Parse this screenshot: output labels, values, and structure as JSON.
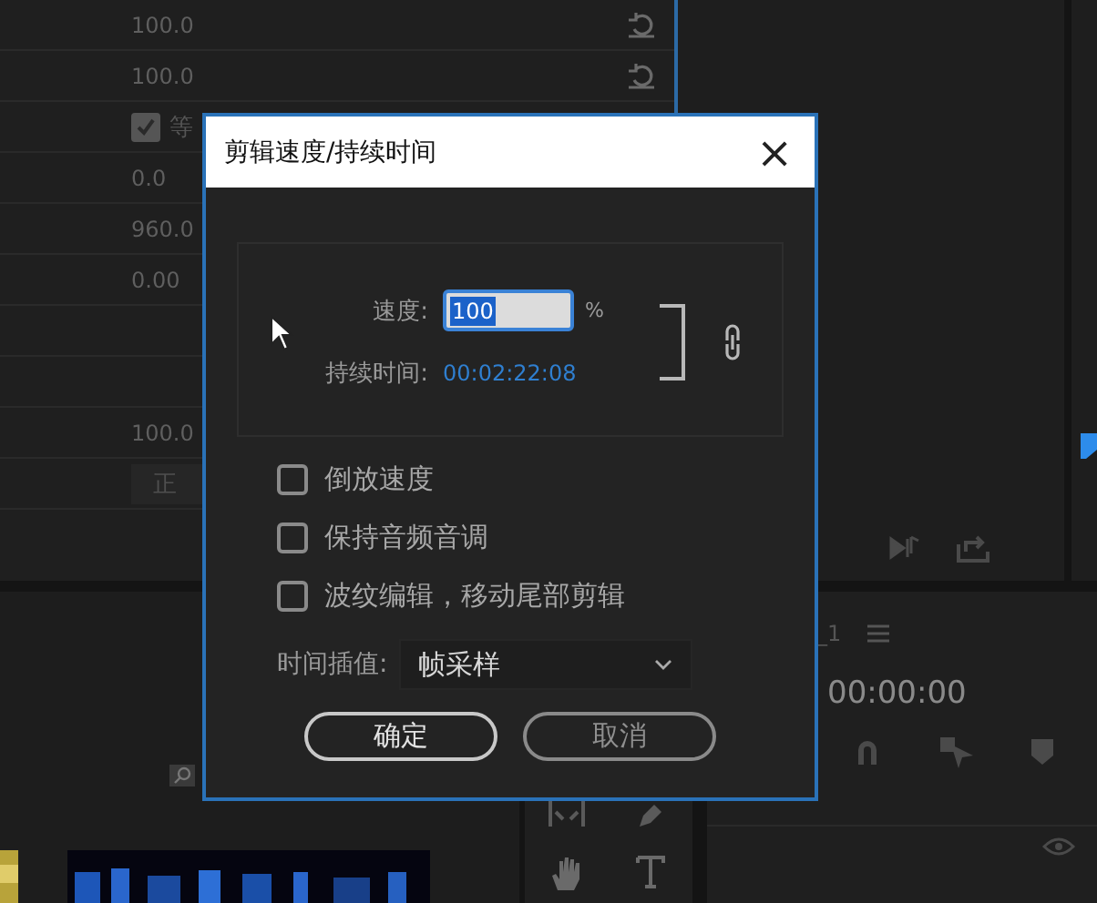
{
  "effect_controls": {
    "rows": [
      {
        "kind": "value_reset",
        "value": "100.0"
      },
      {
        "kind": "value_reset",
        "value": "100.0"
      },
      {
        "kind": "checkbox",
        "label": "等",
        "checked": true
      },
      {
        "kind": "value",
        "value": "0.0"
      },
      {
        "kind": "value",
        "value": "960.0"
      },
      {
        "kind": "value",
        "value": "0.00"
      },
      {
        "kind": "blank"
      },
      {
        "kind": "blank"
      },
      {
        "kind": "value",
        "value": "100.0"
      },
      {
        "kind": "dropdown",
        "value": "正"
      }
    ]
  },
  "timeline": {
    "sequence_name": "_1",
    "timecode": "00:00:00"
  },
  "dialog": {
    "title": "剪辑速度/持续时间",
    "close": "×",
    "speed_label": "速度:",
    "speed_value": "100",
    "speed_unit": "%",
    "duration_label": "持续时间:",
    "duration_value": "00:02:22:08",
    "linked": true,
    "options": [
      {
        "label": "倒放速度",
        "checked": false
      },
      {
        "label": "保持音频音调",
        "checked": false
      },
      {
        "label": "波纹编辑，移动尾部剪辑",
        "checked": false
      }
    ],
    "interpolation_label": "时间插值:",
    "interpolation_value": "帧采样",
    "buttons": [
      {
        "label": "确定",
        "kind": "primary"
      },
      {
        "label": "取消",
        "kind": "secondary"
      }
    ]
  }
}
